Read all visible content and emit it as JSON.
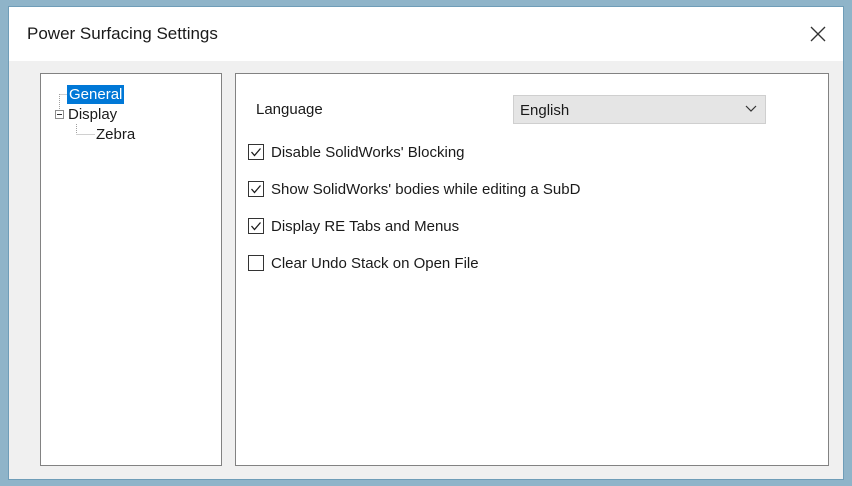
{
  "window": {
    "title": "Power Surfacing Settings",
    "close_icon": "close-icon"
  },
  "tree": {
    "items": [
      {
        "label": "General",
        "selected": true
      },
      {
        "label": "Display",
        "expanded": true
      },
      {
        "label": "Zebra"
      }
    ]
  },
  "general": {
    "language_label": "Language",
    "language_value": "English",
    "options": [
      {
        "label": "Disable SolidWorks' Blocking",
        "checked": true
      },
      {
        "label": "Show SolidWorks' bodies while editing a SubD",
        "checked": true
      },
      {
        "label": "Display RE Tabs and Menus",
        "checked": true
      },
      {
        "label": "Clear Undo Stack on Open File",
        "checked": false
      }
    ]
  },
  "colors": {
    "selection": "#0078d7",
    "window_border": "#6f9db8",
    "desktop": "#8fb4c9"
  }
}
